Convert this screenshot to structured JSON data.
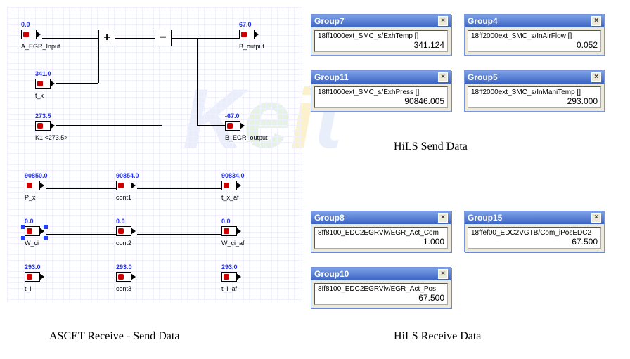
{
  "ascet": {
    "blocks": {
      "a_egr_input": {
        "top": "0.0",
        "name": "A_EGR_Input"
      },
      "t_x": {
        "top": "341.0",
        "name": "t_x"
      },
      "k1": {
        "top": "273.5",
        "name": "K1 <273.5>"
      },
      "b_output": {
        "top": "67.0",
        "name": "B_output"
      },
      "b_egr_output": {
        "top": "-67.0",
        "name": "B_EGR_output"
      },
      "p_x": {
        "top": "90850.0",
        "name": "P_x"
      },
      "cont1": {
        "top": "90854.0",
        "name": "cont1"
      },
      "t_x_af": {
        "top": "90834.0",
        "name": "t_x_af"
      },
      "w_ci": {
        "top": "0.0",
        "name": "W_ci"
      },
      "cont2": {
        "top": "0.0",
        "name": "cont2"
      },
      "w_ci_af": {
        "top": "0.0",
        "name": "W_ci_af"
      },
      "t_i": {
        "top": "293.0",
        "name": "t_i"
      },
      "cont3": {
        "top": "293.0",
        "name": "cont3"
      },
      "t_i_af": {
        "top": "293.0",
        "name": "t_i_af"
      }
    },
    "ops": {
      "plus": "+",
      "minus": "−"
    }
  },
  "hils_send": {
    "group7": {
      "title": "Group7",
      "signal": "18ff1000ext_SMC_s/ExhTemp []",
      "value": "341.124"
    },
    "group4": {
      "title": "Group4",
      "signal": "18ff2000ext_SMC_s/InAirFlow []",
      "value": "0.052"
    },
    "group11": {
      "title": "Group11",
      "signal": "18ff1000ext_SMC_s/ExhPress []",
      "value": "90846.005"
    },
    "group5": {
      "title": "Group5",
      "signal": "18ff2000ext_SMC_s/InManiTemp []",
      "value": "293.000"
    }
  },
  "hils_recv": {
    "group8": {
      "title": "Group8",
      "signal": "8ff8100_EDC2EGRVlv/EGR_Act_Com",
      "value": "1.000"
    },
    "group15": {
      "title": "Group15",
      "signal": "18ffef00_EDC2VGTB/Com_iPosEDC2",
      "value": "67.500"
    },
    "group10": {
      "title": "Group10",
      "signal": "8ff8100_EDC2EGRVlv/EGR_Act_Pos",
      "value": "67.500"
    }
  },
  "captions": {
    "ascet": "ASCET Receive - Send Data",
    "hils_send": "HiLS Send Data",
    "hils_recv": "HiLS Receive Data"
  },
  "ui": {
    "close_x": "×"
  }
}
